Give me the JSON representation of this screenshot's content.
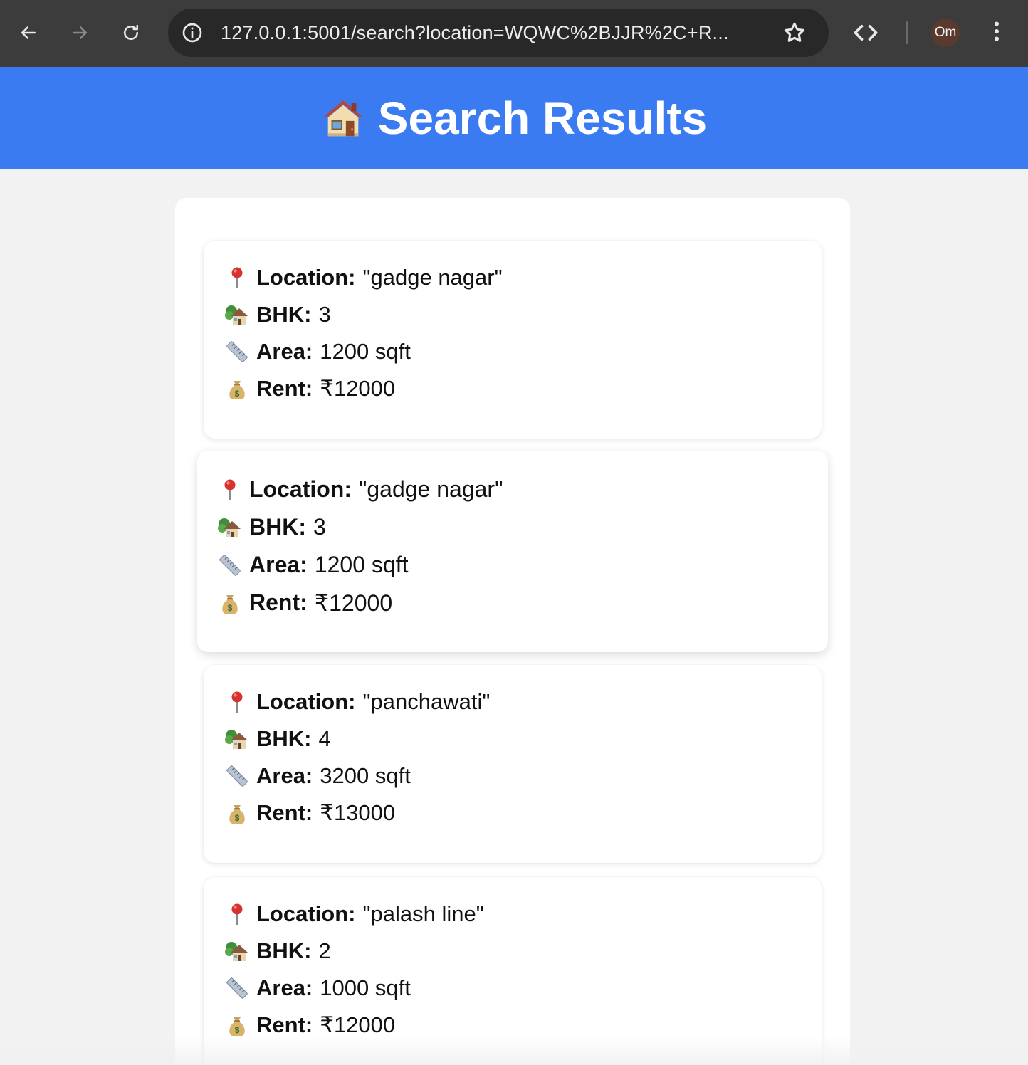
{
  "browser": {
    "url": "127.0.0.1:5001/search?location=WQWC%2BJJR%2C+R...",
    "profile_initials": "Om",
    "icons": [
      "back-arrow-icon",
      "forward-arrow-icon",
      "reload-icon",
      "info-icon",
      "star-icon",
      "code-icon",
      "kebab-menu-icon"
    ]
  },
  "header": {
    "title": "Search Results",
    "icon": "house-icon",
    "background": "#3a7bf2"
  },
  "labels": {
    "location": "Location:",
    "bhk": "BHK:",
    "area": "Area:",
    "rent": "Rent:"
  },
  "results": [
    {
      "location": "\"gadge nagar\"",
      "bhk": "3",
      "area": "1200 sqft",
      "rent": "₹12000"
    },
    {
      "location": "\"gadge nagar\"",
      "bhk": "3",
      "area": "1200 sqft",
      "rent": "₹12000"
    },
    {
      "location": "\"panchawati\"",
      "bhk": "4",
      "area": "3200 sqft",
      "rent": "₹13000"
    },
    {
      "location": "\"palash line\"",
      "bhk": "2",
      "area": "1000 sqft",
      "rent": "₹12000"
    }
  ]
}
